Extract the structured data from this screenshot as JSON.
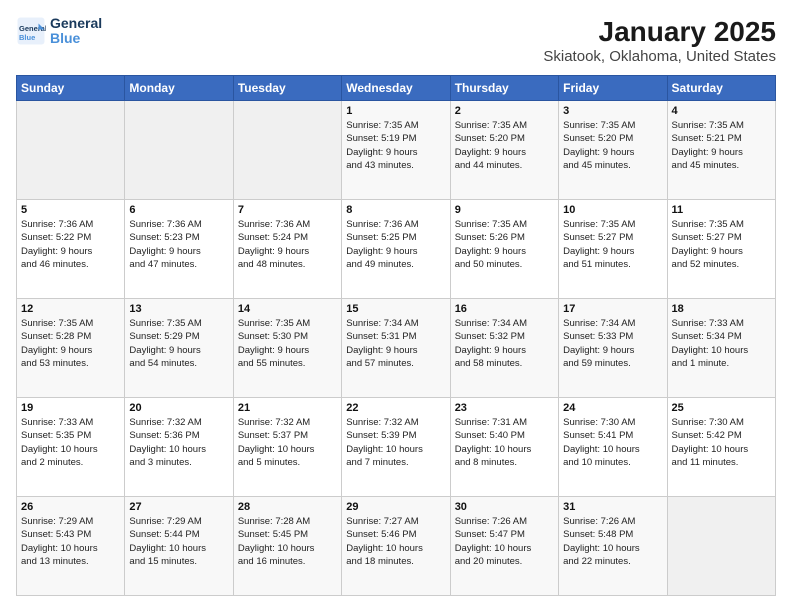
{
  "header": {
    "logo_line1": "General",
    "logo_line2": "Blue",
    "title": "January 2025",
    "subtitle": "Skiatook, Oklahoma, United States"
  },
  "calendar": {
    "days": [
      "Sunday",
      "Monday",
      "Tuesday",
      "Wednesday",
      "Thursday",
      "Friday",
      "Saturday"
    ],
    "weeks": [
      [
        {
          "date": "",
          "content": ""
        },
        {
          "date": "",
          "content": ""
        },
        {
          "date": "",
          "content": ""
        },
        {
          "date": "1",
          "content": "Sunrise: 7:35 AM\nSunset: 5:19 PM\nDaylight: 9 hours\nand 43 minutes."
        },
        {
          "date": "2",
          "content": "Sunrise: 7:35 AM\nSunset: 5:20 PM\nDaylight: 9 hours\nand 44 minutes."
        },
        {
          "date": "3",
          "content": "Sunrise: 7:35 AM\nSunset: 5:20 PM\nDaylight: 9 hours\nand 45 minutes."
        },
        {
          "date": "4",
          "content": "Sunrise: 7:35 AM\nSunset: 5:21 PM\nDaylight: 9 hours\nand 45 minutes."
        }
      ],
      [
        {
          "date": "5",
          "content": "Sunrise: 7:36 AM\nSunset: 5:22 PM\nDaylight: 9 hours\nand 46 minutes."
        },
        {
          "date": "6",
          "content": "Sunrise: 7:36 AM\nSunset: 5:23 PM\nDaylight: 9 hours\nand 47 minutes."
        },
        {
          "date": "7",
          "content": "Sunrise: 7:36 AM\nSunset: 5:24 PM\nDaylight: 9 hours\nand 48 minutes."
        },
        {
          "date": "8",
          "content": "Sunrise: 7:36 AM\nSunset: 5:25 PM\nDaylight: 9 hours\nand 49 minutes."
        },
        {
          "date": "9",
          "content": "Sunrise: 7:35 AM\nSunset: 5:26 PM\nDaylight: 9 hours\nand 50 minutes."
        },
        {
          "date": "10",
          "content": "Sunrise: 7:35 AM\nSunset: 5:27 PM\nDaylight: 9 hours\nand 51 minutes."
        },
        {
          "date": "11",
          "content": "Sunrise: 7:35 AM\nSunset: 5:27 PM\nDaylight: 9 hours\nand 52 minutes."
        }
      ],
      [
        {
          "date": "12",
          "content": "Sunrise: 7:35 AM\nSunset: 5:28 PM\nDaylight: 9 hours\nand 53 minutes."
        },
        {
          "date": "13",
          "content": "Sunrise: 7:35 AM\nSunset: 5:29 PM\nDaylight: 9 hours\nand 54 minutes."
        },
        {
          "date": "14",
          "content": "Sunrise: 7:35 AM\nSunset: 5:30 PM\nDaylight: 9 hours\nand 55 minutes."
        },
        {
          "date": "15",
          "content": "Sunrise: 7:34 AM\nSunset: 5:31 PM\nDaylight: 9 hours\nand 57 minutes."
        },
        {
          "date": "16",
          "content": "Sunrise: 7:34 AM\nSunset: 5:32 PM\nDaylight: 9 hours\nand 58 minutes."
        },
        {
          "date": "17",
          "content": "Sunrise: 7:34 AM\nSunset: 5:33 PM\nDaylight: 9 hours\nand 59 minutes."
        },
        {
          "date": "18",
          "content": "Sunrise: 7:33 AM\nSunset: 5:34 PM\nDaylight: 10 hours\nand 1 minute."
        }
      ],
      [
        {
          "date": "19",
          "content": "Sunrise: 7:33 AM\nSunset: 5:35 PM\nDaylight: 10 hours\nand 2 minutes."
        },
        {
          "date": "20",
          "content": "Sunrise: 7:32 AM\nSunset: 5:36 PM\nDaylight: 10 hours\nand 3 minutes."
        },
        {
          "date": "21",
          "content": "Sunrise: 7:32 AM\nSunset: 5:37 PM\nDaylight: 10 hours\nand 5 minutes."
        },
        {
          "date": "22",
          "content": "Sunrise: 7:32 AM\nSunset: 5:39 PM\nDaylight: 10 hours\nand 7 minutes."
        },
        {
          "date": "23",
          "content": "Sunrise: 7:31 AM\nSunset: 5:40 PM\nDaylight: 10 hours\nand 8 minutes."
        },
        {
          "date": "24",
          "content": "Sunrise: 7:30 AM\nSunset: 5:41 PM\nDaylight: 10 hours\nand 10 minutes."
        },
        {
          "date": "25",
          "content": "Sunrise: 7:30 AM\nSunset: 5:42 PM\nDaylight: 10 hours\nand 11 minutes."
        }
      ],
      [
        {
          "date": "26",
          "content": "Sunrise: 7:29 AM\nSunset: 5:43 PM\nDaylight: 10 hours\nand 13 minutes."
        },
        {
          "date": "27",
          "content": "Sunrise: 7:29 AM\nSunset: 5:44 PM\nDaylight: 10 hours\nand 15 minutes."
        },
        {
          "date": "28",
          "content": "Sunrise: 7:28 AM\nSunset: 5:45 PM\nDaylight: 10 hours\nand 16 minutes."
        },
        {
          "date": "29",
          "content": "Sunrise: 7:27 AM\nSunset: 5:46 PM\nDaylight: 10 hours\nand 18 minutes."
        },
        {
          "date": "30",
          "content": "Sunrise: 7:26 AM\nSunset: 5:47 PM\nDaylight: 10 hours\nand 20 minutes."
        },
        {
          "date": "31",
          "content": "Sunrise: 7:26 AM\nSunset: 5:48 PM\nDaylight: 10 hours\nand 22 minutes."
        },
        {
          "date": "",
          "content": ""
        }
      ]
    ]
  }
}
